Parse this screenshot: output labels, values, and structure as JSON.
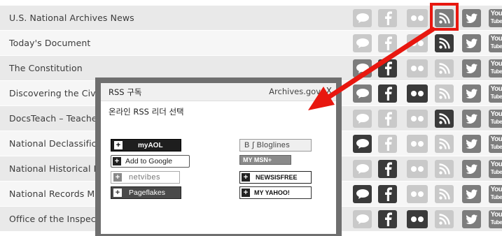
{
  "rows": [
    {
      "title": "U.S. National Archives News",
      "shade": true,
      "tone": "light"
    },
    {
      "title": "Today's Document",
      "shade": false,
      "tone": "mixed1"
    },
    {
      "title": "The Constitution",
      "shade": true,
      "tone": "mixed2"
    },
    {
      "title": "Discovering the Civil",
      "shade": false,
      "tone": "dark"
    },
    {
      "title": "DocsTeach – Teache",
      "shade": true,
      "tone": "mixed3"
    },
    {
      "title": "National Declassifica",
      "shade": false,
      "tone": "dark2"
    },
    {
      "title": "National Historical Pu",
      "shade": true,
      "tone": "mixed4"
    },
    {
      "title": "National Records Ma",
      "shade": false,
      "tone": "dark3"
    },
    {
      "title": "Office of the Inspect",
      "shade": true,
      "tone": "mixed5"
    }
  ],
  "youtube": {
    "top": "You",
    "bottom": "Tube"
  },
  "popup": {
    "title": "RSS 구독",
    "site": "Archives.gov",
    "close": "X",
    "subtitle": "온라인 RSS 리더 선택",
    "readers": {
      "aol": "myAOL",
      "google": "Add to Google",
      "netvibes": "netvibes",
      "pageflakes": "Pageflakes",
      "bloglines": "B ∫ Bloglines",
      "msn": "MY MSN+",
      "newsisfree": "NEWSISFREE",
      "yahoo": "MY YAHOO!"
    },
    "plus": "+"
  },
  "colors": {
    "highlight": "#e8170f",
    "arrow": "#e8170f"
  }
}
